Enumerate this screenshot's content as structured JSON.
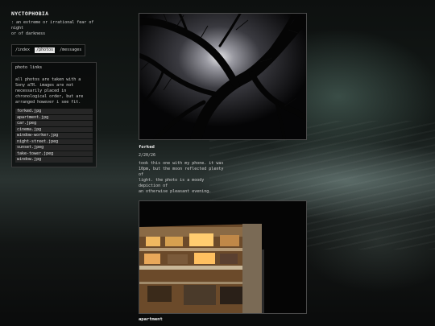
{
  "site": {
    "title": "NYCTOPHOBIA",
    "tagline": ": an extreme or irrational fear of night\nor of darkness"
  },
  "nav": {
    "index": "/index",
    "photos": "/photos",
    "messages": "/messages"
  },
  "photo_links": {
    "title": "photo links",
    "description": "all photos are taken with a Sony a7R.\nimages are not necessarily placed in\nchronological order, but are arranged\nhowever i see fit.",
    "files": [
      "forked.jpg",
      "apartment.jpg",
      "car.jpeg",
      "cinema.jpg",
      "window-worker.jpg",
      "night-street.jpeg",
      "sunset.jpeg",
      "take-tower.jpeg",
      "window.jpg"
    ]
  },
  "posts": [
    {
      "title": "forked",
      "date": "2/20/26",
      "body": "took this one with my phone. it was\n10pm, but the moon reflected plenty of\nlight. the photo is a moody depiction of\nan otherwise pleasant evening."
    },
    {
      "title": "apartment"
    }
  ],
  "colors": {
    "background": "#0b0c0c",
    "text": "#d9d9d9",
    "nav_active_bg": "#e6e6e6"
  }
}
